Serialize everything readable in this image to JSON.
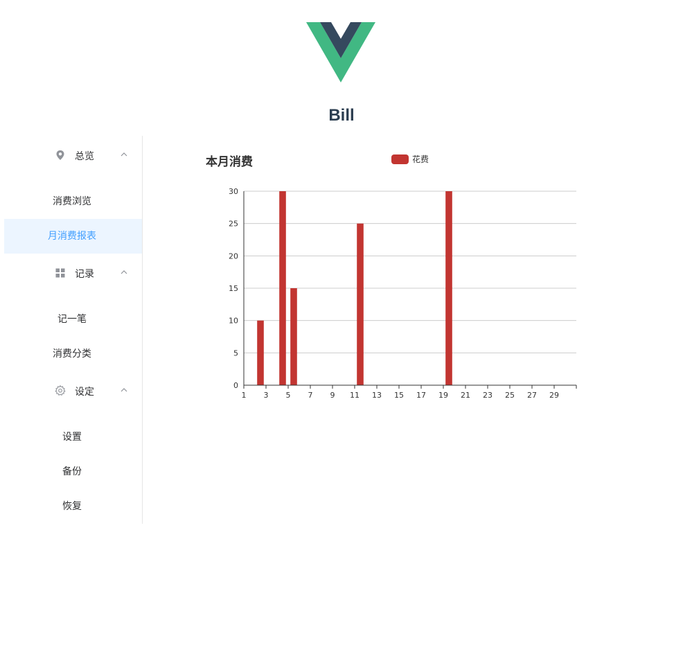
{
  "app": {
    "title": "Bill"
  },
  "sidebar": {
    "groups": [
      {
        "label": "总览",
        "icon": "location-icon",
        "items": [
          {
            "label": "消费浏览",
            "active": false
          },
          {
            "label": "月消费报表",
            "active": true
          }
        ]
      },
      {
        "label": "记录",
        "icon": "grid-icon",
        "items": [
          {
            "label": "记一笔",
            "active": false
          },
          {
            "label": "消费分类",
            "active": false
          }
        ]
      },
      {
        "label": "设定",
        "icon": "gear-icon",
        "items": [
          {
            "label": "设置",
            "active": false
          },
          {
            "label": "备份",
            "active": false
          },
          {
            "label": "恢复",
            "active": false
          }
        ]
      }
    ]
  },
  "colors": {
    "accent": "#409eff",
    "active_bg": "#ecf5ff",
    "bar": "#c23531",
    "vue_green": "#41b883",
    "vue_dark": "#35495e"
  },
  "chart_data": {
    "type": "bar",
    "title": "本月消费",
    "legend": [
      "花费"
    ],
    "legend_position": "top-center",
    "x": [
      1,
      2,
      3,
      4,
      5,
      6,
      7,
      8,
      9,
      10,
      11,
      12,
      13,
      14,
      15,
      16,
      17,
      18,
      19,
      20,
      21,
      22,
      23,
      24,
      25,
      26,
      27,
      28,
      29,
      30
    ],
    "series": [
      {
        "name": "花费",
        "values": [
          0,
          10,
          0,
          30,
          15,
          0,
          0,
          0,
          0,
          0,
          25,
          0,
          0,
          0,
          0,
          0,
          0,
          0,
          30,
          0,
          0,
          0,
          0,
          0,
          0,
          0,
          0,
          0,
          0,
          0
        ]
      }
    ],
    "x_tick_labels": [
      "1",
      "3",
      "5",
      "7",
      "9",
      "11",
      "13",
      "15",
      "17",
      "19",
      "21",
      "23",
      "25",
      "27",
      "29"
    ],
    "ylim": [
      0,
      30
    ],
    "yticks": [
      0,
      5,
      10,
      15,
      20,
      25,
      30
    ],
    "grid": true
  }
}
